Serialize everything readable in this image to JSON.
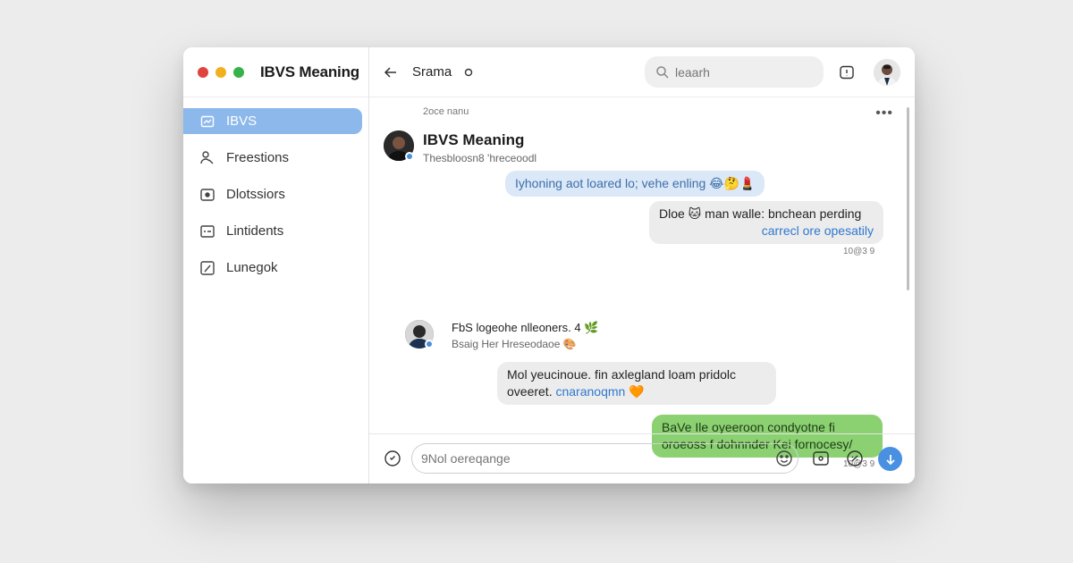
{
  "app": {
    "title": "IBVS Meaning",
    "traffic_lights": [
      "#e0443e",
      "#f2b01e",
      "#36b24a"
    ]
  },
  "sidebar": {
    "items": [
      {
        "label": "IBVS",
        "icon": "chart-icon",
        "active": true
      },
      {
        "label": "Freestions",
        "icon": "user-icon",
        "active": false
      },
      {
        "label": "Dlotssiors",
        "icon": "record-icon",
        "active": false
      },
      {
        "label": "Lintidents",
        "icon": "message-icon",
        "active": false
      },
      {
        "label": "Lunegok",
        "icon": "edit-icon",
        "active": false
      }
    ]
  },
  "header": {
    "back_icon": "arrow-left-icon",
    "chat_title": "Srama",
    "status_icon": "circle-icon",
    "search": {
      "placeholder": "leaarh"
    },
    "notification_icon": "bell-icon",
    "avatar_icon": "user-avatar"
  },
  "conversation": {
    "timestamp_top": "2oce nanu",
    "more_icon": "more-horizontal-icon",
    "sender1": {
      "name": "IBVS Meaning",
      "sub": "Thesbloosn8 'hreceoodl"
    },
    "msg1": {
      "text": "Iyhoning aot loared lo; vehe enling 😂🤔💄"
    },
    "msg2": {
      "line1": "Dloe 🐱 man walle: bnchean perding",
      "line2": "carrecl ore opesatily"
    },
    "msg2_time": "10@3 9",
    "sender2": {
      "name": "FbS logeohe nlleoners. 4 🌿",
      "sub": "Bsaig Her Hreseodaoe 🎨"
    },
    "msg3": {
      "line1": "Mol yeucinoue. fin axlegland loam pridolc",
      "line2_a": "oveeret.",
      "line2_b": "cnaranoqmn 🧡"
    },
    "msg4": {
      "line1": "BaVe Ile oyeeroon condyotne fi",
      "line2": "oroeoss f dohnnder Kei fornocesy/"
    },
    "msg4_time": "10@3 9"
  },
  "composer": {
    "attach_icon": "compass-icon",
    "placeholder": "9Nol oereqange",
    "emoji_icon": "emoji-icon",
    "media_icon": "image-icon",
    "link_icon": "link-icon",
    "send_icon": "arrow-down-icon"
  },
  "colors": {
    "accent": "#8cb8ec",
    "bubble_blue": "#dbe8f8",
    "bubble_gray": "#ececec",
    "bubble_green": "#8bd172",
    "send_button": "#4a90e2"
  }
}
